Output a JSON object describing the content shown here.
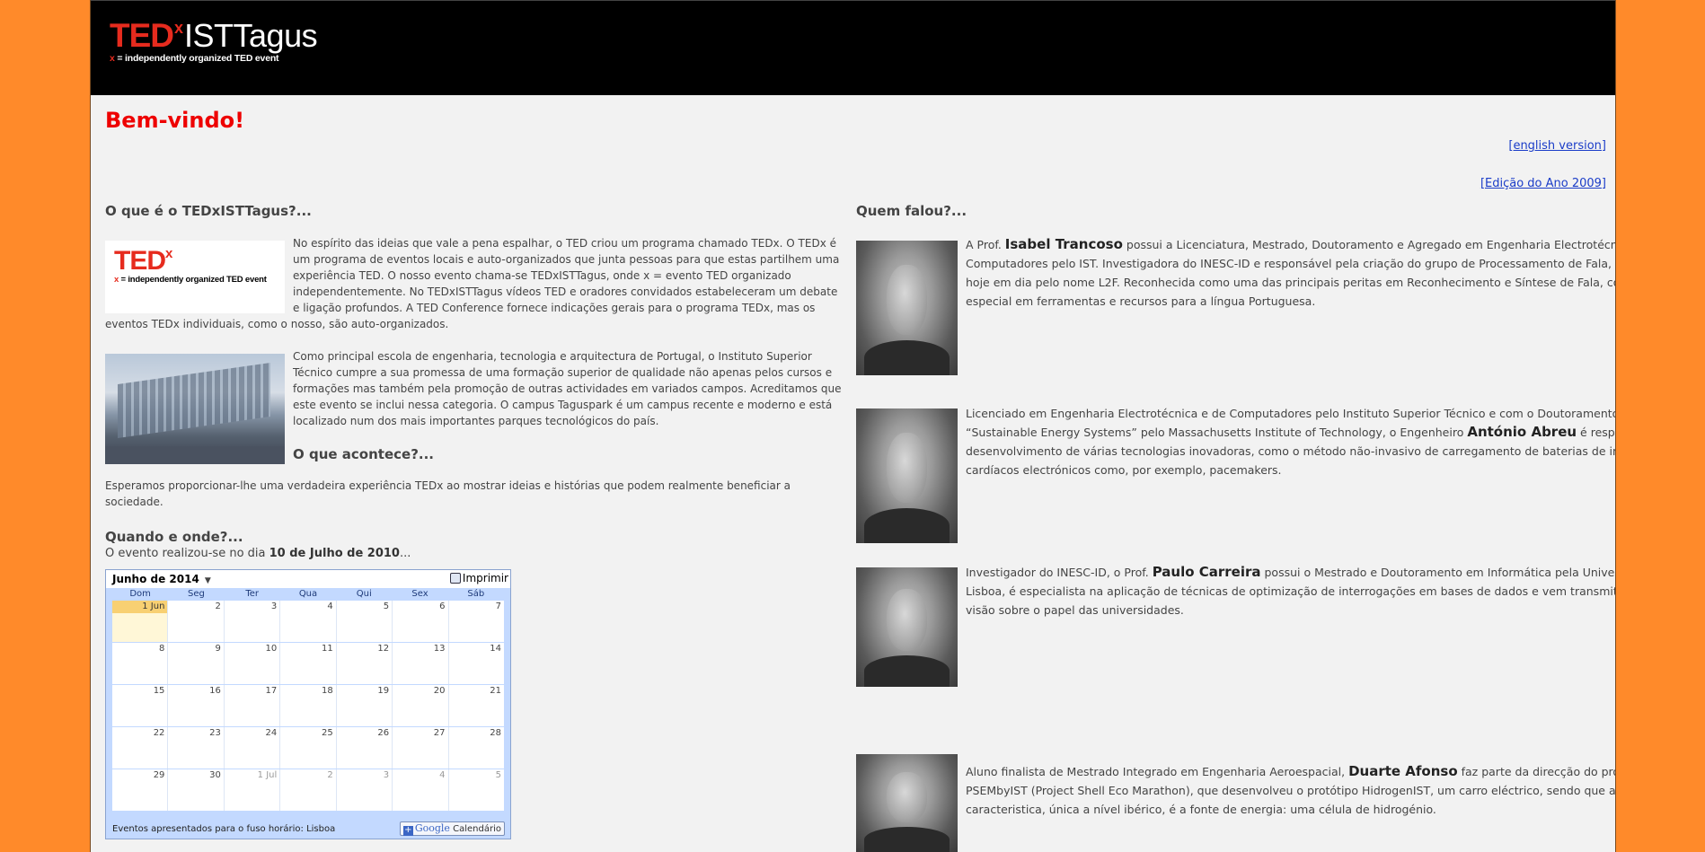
{
  "header": {
    "logo_ted": "TED",
    "logo_x": "x",
    "logo_name": "ISTTagus",
    "logo_tagline_x": "x",
    "logo_tagline": " = independently organized TED event"
  },
  "page_title": "Bem-vindo!",
  "links": {
    "english": "[english version]",
    "edition2009": "[Edição do Ano 2009]"
  },
  "left": {
    "what_heading": "O que é o TEDxISTTagus?...",
    "ted_thumb_text": "TED",
    "ted_thumb_x": "x",
    "ted_thumb_tagline_x": "x",
    "ted_thumb_tagline": " = independently organized TED event",
    "para1": "No espírito das ideias que vale a pena espalhar, o TED criou um programa chamado TEDx. O TEDx é um programa de eventos locais e auto-organizados que junta pessoas para que estas partilhem uma experiência TED. O nosso evento chama-se TEDxISTTagus, onde x = evento TED organizado independentemente. No TEDxISTTagus vídeos TED e oradores convidados estabeleceram um debate e ligação profundos. A TED Conference fornece indicações gerais para o programa TEDx, mas os eventos TEDx individuais, como o nosso, são auto-organizados.",
    "para2": "Como principal escola de engenharia, tecnologia e arquitectura de Portugal, o Instituto Superior Técnico cumpre a sua promessa de uma formação superior de qualidade não apenas pelos cursos e formações mas também pela promoção de outras actividades em variados campos. Acreditamos que este evento se inclui nessa categoria. O campus Taguspark é um campus recente e moderno e está localizado num dos mais importantes parques tecnológicos do país.",
    "happens_heading": "O que acontece?...",
    "para3": "Esperamos proporcionar-lhe uma verdadeira experiência TEDx ao mostrar ideias e histórias que podem realmente beneficiar a sociedade.",
    "when_heading": "Quando e onde?...",
    "event_prefix": "O evento realizou-se no dia ",
    "event_date": "10 de Julho de 2010",
    "event_suffix": "..."
  },
  "calendar": {
    "month": "Junho de 2014",
    "print_label": "Imprimir",
    "weekdays": [
      "Dom",
      "Seg",
      "Ter",
      "Qua",
      "Qui",
      "Sex",
      "Sáb"
    ],
    "weeks": [
      [
        "1 Jun",
        "2",
        "3",
        "4",
        "5",
        "6",
        "7"
      ],
      [
        "8",
        "9",
        "10",
        "11",
        "12",
        "13",
        "14"
      ],
      [
        "15",
        "16",
        "17",
        "18",
        "19",
        "20",
        "21"
      ],
      [
        "22",
        "23",
        "24",
        "25",
        "26",
        "27",
        "28"
      ],
      [
        "29",
        "30",
        "1 Jul",
        "2",
        "3",
        "4",
        "5"
      ]
    ],
    "timezone_note": "Eventos apresentados para o fuso horário: Lisboa",
    "gcal_plus": "+",
    "gcal_google": "Google",
    "gcal_label": " Calendário"
  },
  "right": {
    "heading": "Quem falou?...",
    "speakers": [
      {
        "pre": "A Prof. ",
        "name": "Isabel Trancoso",
        "post": " possui a Licenciatura, Mestrado, Doutoramento e Agregado em Engenharia Electrotécnica e de Computadores pelo IST. Investigadora do INESC-ID e responsável pela criação do grupo de Processamento de Fala, conhecido hoje em dia pelo nome L2F. Reconhecida como uma das principais peritas em Reconhecimento e Síntese de Fala, com ênfase especial em ferramentas e recursos para a língua Portuguesa."
      },
      {
        "pre": "Licenciado em Engenharia Electrotécnica e de Computadores pelo Instituto Superior Técnico e com o Doutoramento em “Sustainable Energy Systems” pelo Massachusetts Institute of Technology, o Engenheiro ",
        "name": "António Abreu",
        "post": " é responsável pelo desenvolvimento de várias tecnologias inovadoras, como o método não-invasivo de carregamento de baterias de implantes cardíacos electrónicos como, por exemplo, pacemakers."
      },
      {
        "pre": "Investigador do INESC-ID, o Prof. ",
        "name": "Paulo Carreira",
        "post": " possui o Mestrado e Doutoramento em Informática pela Universidade de Lisboa, é especialista na aplicação de técnicas de optimização de interrogações em bases de dados e vem transmitir uma nova visão sobre o papel das universidades."
      },
      {
        "pre": "Aluno finalista de Mestrado Integrado em Engenharia Aeroespacial, ",
        "name": "Duarte Afonso",
        "post": " faz parte da direcção do projecto PSEMbyIST (Project Shell Eco Marathon), que desenvolveu o protótipo HidrogenIST, um carro eléctrico, sendo que a sua principal caracteristica, única a nível ibérico, é a fonte de energia: uma célula de hidrogénio."
      }
    ]
  },
  "colors": {
    "background_orange": "#ff8a2a",
    "content_bg": "#f2f2f2",
    "ted_red": "#e62b1e",
    "title_red": "#ee0000",
    "link_blue": "#1a3cc8"
  }
}
